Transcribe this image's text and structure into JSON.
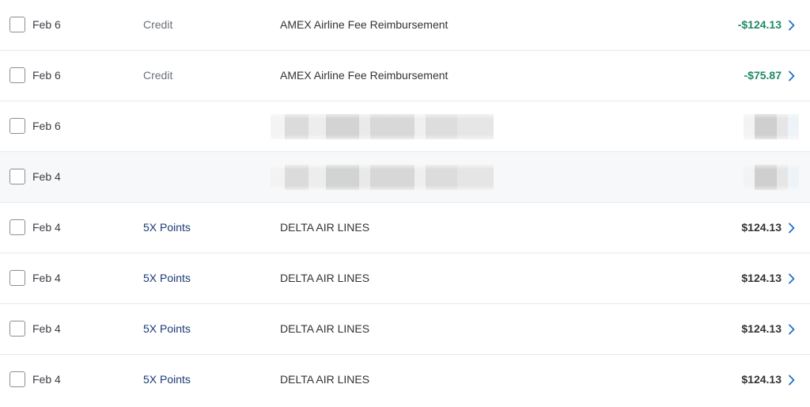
{
  "colors": {
    "credit_amount": "#1f8a62",
    "points_label": "#1a3a73",
    "chevron": "#1a73c9",
    "divider": "#e6e8eb",
    "highlight_row": "#f7f8fa"
  },
  "transactions": [
    {
      "date": "Feb 6",
      "category": "Credit",
      "description": "AMEX Airline Fee Reimbursement",
      "amount": "-$124.13"
    },
    {
      "date": "Feb 6",
      "category": "Credit",
      "description": "AMEX Airline Fee Reimbursement",
      "amount": "-$75.87"
    },
    {
      "date": "Feb 6",
      "category": "",
      "description": "",
      "amount": ""
    },
    {
      "date": "Feb 4",
      "category": "",
      "description": "",
      "amount": ""
    },
    {
      "date": "Feb 4",
      "category": "5X Points",
      "description": "DELTA AIR LINES",
      "amount": "$124.13"
    },
    {
      "date": "Feb 4",
      "category": "5X Points",
      "description": "DELTA AIR LINES",
      "amount": "$124.13"
    },
    {
      "date": "Feb 4",
      "category": "5X Points",
      "description": "DELTA AIR LINES",
      "amount": "$124.13"
    },
    {
      "date": "Feb 4",
      "category": "5X Points",
      "description": "DELTA AIR LINES",
      "amount": "$124.13"
    }
  ]
}
